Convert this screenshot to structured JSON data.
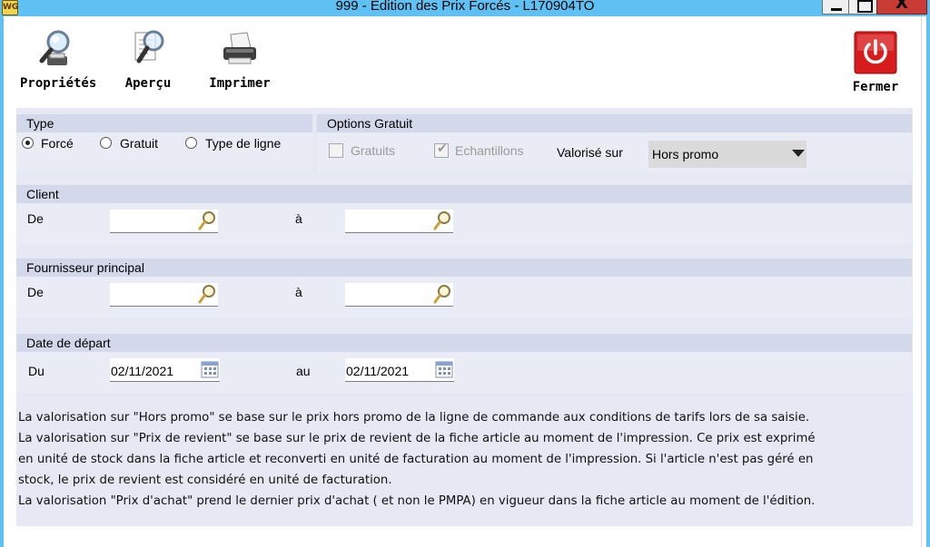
{
  "window": {
    "title": "999 - Edition des Prix Forcés - L170904TO",
    "app_icon_text": "WG",
    "close_glyph": "X"
  },
  "toolbar": {
    "proprietes": "Propriétés",
    "apercu": "Aperçu",
    "imprimer": "Imprimer",
    "fermer": "Fermer"
  },
  "type_section": {
    "title": "Type",
    "options": [
      "Forcé",
      "Gratuit",
      "Type de ligne"
    ],
    "selected": "Forcé"
  },
  "options_gratuit": {
    "title": "Options Gratuit",
    "gratuits_label": "Gratuits",
    "gratuits_checked": false,
    "echantillons_label": "Echantillons",
    "echantillons_checked": true,
    "valorise_label": "Valorisé sur",
    "valorise_value": "Hors promo"
  },
  "client": {
    "title": "Client",
    "from_label": "De",
    "to_label": "à",
    "from_value": "",
    "to_value": ""
  },
  "fournisseur": {
    "title": "Fournisseur principal",
    "from_label": "De",
    "to_label": "à",
    "from_value": "",
    "to_value": ""
  },
  "date_depart": {
    "title": "Date de départ",
    "from_label": "Du",
    "to_label": "au",
    "from_value": "02/11/2021",
    "to_value": "02/11/2021"
  },
  "info_lines": [
    "La valorisation sur \"Hors promo\" se base sur le prix hors promo de la ligne de commande aux conditions de tarifs lors de sa saisie.",
    "La valorisation sur \"Prix de revient\" se base sur le prix de revient de la fiche article au moment de l'impression. Ce prix est exprimé",
    "en unité de stock dans la fiche article et reconverti en unité de facturation au moment de l'impression. Si l'article n'est pas géré en",
    "stock, le prix de revient est considéré en unité de facturation.",
    "La valorisation \"Prix d'achat\" prend le dernier prix d'achat ( et non le PMPA) en vigueur dans la fiche article au moment de l'édition."
  ],
  "colors": {
    "title_bar": "#5fc1f3",
    "close_button": "#c83c35",
    "section_header": "#d3d8ea",
    "panel": "#e6e9f3",
    "fermer_icon": "#d81c1c"
  },
  "icons": {
    "proprietes": "magnifier-printer-icon",
    "apercu": "magnifier-page-icon",
    "imprimer": "printer-icon",
    "fermer": "power-icon",
    "lookup": "magnifier-icon",
    "calendar": "calendar-icon"
  }
}
